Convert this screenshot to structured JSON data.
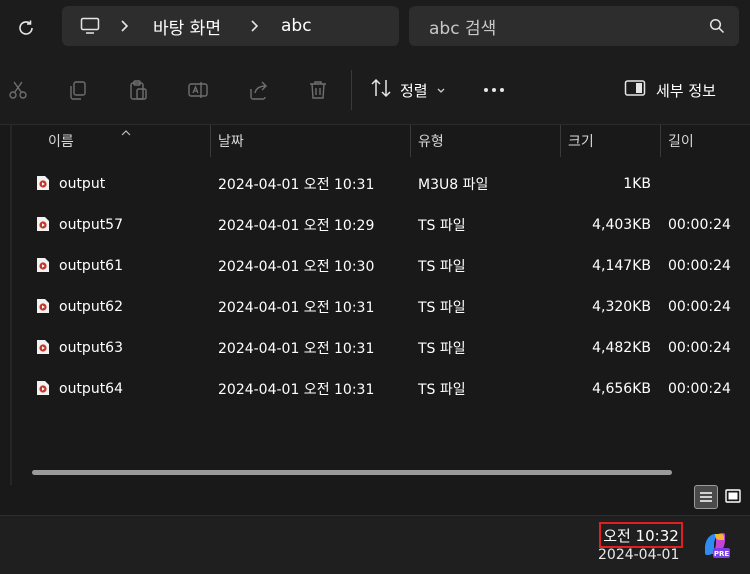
{
  "breadcrumb": {
    "items": [
      "바탕 화면",
      "abc"
    ]
  },
  "search": {
    "placeholder": "abc 검색"
  },
  "toolbar": {
    "sort_label": "정렬",
    "details_label": "세부 정보"
  },
  "columns": [
    "이름",
    "날짜",
    "유형",
    "크기",
    "길이"
  ],
  "files": [
    {
      "name": "output",
      "date": "2024-04-01 오전 10:31",
      "type": "M3U8 파일",
      "size": "1KB",
      "length": ""
    },
    {
      "name": "output57",
      "date": "2024-04-01 오전 10:29",
      "type": "TS 파일",
      "size": "4,403KB",
      "length": "00:00:24"
    },
    {
      "name": "output61",
      "date": "2024-04-01 오전 10:30",
      "type": "TS 파일",
      "size": "4,147KB",
      "length": "00:00:24"
    },
    {
      "name": "output62",
      "date": "2024-04-01 오전 10:31",
      "type": "TS 파일",
      "size": "4,320KB",
      "length": "00:00:24"
    },
    {
      "name": "output63",
      "date": "2024-04-01 오전 10:31",
      "type": "TS 파일",
      "size": "4,482KB",
      "length": "00:00:24"
    },
    {
      "name": "output64",
      "date": "2024-04-01 오전 10:31",
      "type": "TS 파일",
      "size": "4,656KB",
      "length": "00:00:24"
    }
  ],
  "taskbar": {
    "time": "오전 10:32",
    "date": "2024-04-01",
    "copilot_badge": "PRE"
  },
  "colors": {
    "background": "#1c1c1c",
    "highlight_box": "#e02020"
  },
  "icons": [
    "refresh-icon",
    "computer-icon",
    "chevron-right-icon",
    "search-icon",
    "cut-icon",
    "copy-icon",
    "paste-icon",
    "rename-icon",
    "share-icon",
    "delete-icon",
    "sort-icon",
    "chevron-down-icon",
    "more-icon",
    "details-pane-icon",
    "video-file-icon",
    "details-view-icon",
    "tiles-view-icon",
    "copilot-icon"
  ]
}
